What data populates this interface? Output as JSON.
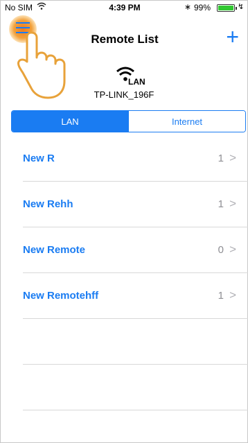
{
  "status_bar": {
    "carrier": "No SIM",
    "time": "4:39 PM",
    "battery_pct": "99%"
  },
  "navbar": {
    "title": "Remote List",
    "add_label": "+"
  },
  "network": {
    "type_label": "LAN",
    "name": "TP-LINK_196F"
  },
  "segments": [
    {
      "label": "LAN",
      "active": true
    },
    {
      "label": "Internet",
      "active": false
    }
  ],
  "remotes": [
    {
      "name": "New R",
      "count": "1"
    },
    {
      "name": "New Rehh",
      "count": "1"
    },
    {
      "name": "New Remote",
      "count": "0"
    },
    {
      "name": "New Remotehff",
      "count": "1"
    }
  ],
  "colors": {
    "accent": "#1a7cf2",
    "tap_highlight": "#f07a1a",
    "battery": "#32c832"
  },
  "icons": [
    "wifi-icon",
    "bluetooth-icon",
    "battery-icon",
    "menu-icon",
    "add-icon",
    "chevron-right-icon",
    "hand-pointer-icon"
  ]
}
